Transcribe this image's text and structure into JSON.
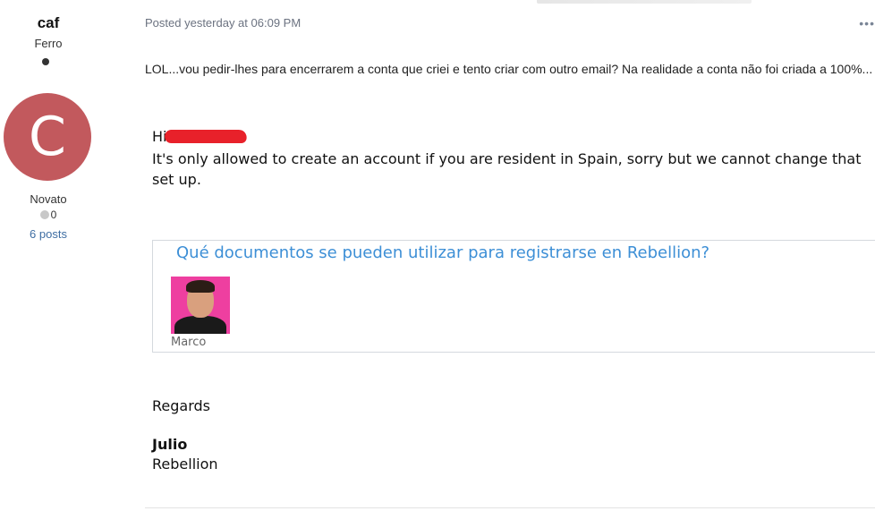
{
  "author": {
    "name": "caf",
    "rank": "Ferro",
    "avatar_letter": "C",
    "avatar_color": "#c2595d",
    "group": "Novato",
    "reputation": "0",
    "posts": "6 posts"
  },
  "post": {
    "meta": "Posted yesterday at 06:09 PM",
    "more_icon": "ellipsis-icon",
    "intro": "LOL...vou pedir-lhes para encerrarem a conta que criei e tento criar com outro email? Na realidade a conta não foi criada a 100%...",
    "quote": {
      "greeting": "Hi",
      "body": "It's only allowed to create an account if you are resident in Spain, sorry but we cannot change that set up.",
      "link_card": {
        "title": "Qué documentos se pueden utilizar para registrarse en Rebellion?",
        "author": "Marco",
        "accent": "#3d8fd6"
      },
      "closing": "Regards",
      "signature_name": "Julio",
      "signature_company": "Rebellion"
    }
  }
}
